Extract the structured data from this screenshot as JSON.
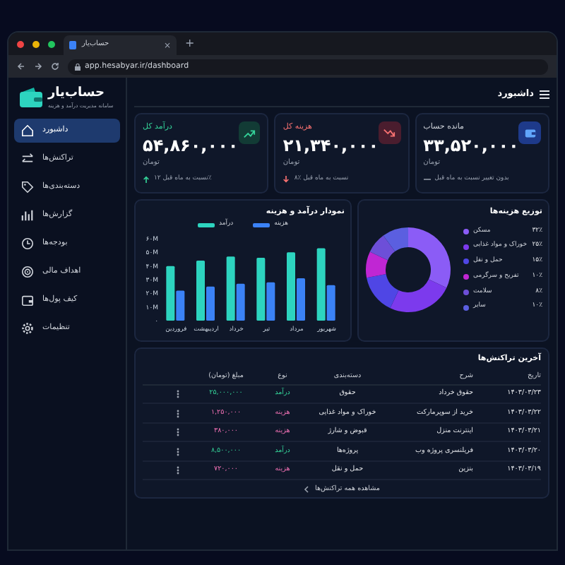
{
  "browser": {
    "tab_title": "حساب‌یار",
    "tab_close": "×",
    "new_tab": "+",
    "url": "app.hesabyar.ir/dashboard"
  },
  "sidebar": {
    "app_name": "حساب‌یار",
    "app_subtitle": "سامانه مدیریت درآمد و هزینه",
    "items": [
      {
        "label": "داشبورد",
        "selected": true
      },
      {
        "label": "تراکنش‌ها",
        "selected": false
      },
      {
        "label": "دسته‌بندی‌ها",
        "selected": false
      },
      {
        "label": "گزارش‌ها",
        "selected": false
      },
      {
        "label": "بودجه‌ها",
        "selected": false
      },
      {
        "label": "اهداف مالی",
        "selected": false
      },
      {
        "label": "کیف پول‌ها",
        "selected": false
      },
      {
        "label": "تنظیمات",
        "selected": false
      }
    ]
  },
  "header": {
    "title": "داشبورد"
  },
  "cards": [
    {
      "kind": "balance",
      "title": "مانده حساب",
      "value": "۳۳,۵۲۰,۰۰۰",
      "unit": "تومان",
      "change": "بدون تغییر نسبت به ماه قبل"
    },
    {
      "kind": "expense",
      "title": "هزینه کل",
      "value": "۲۱,۳۴۰,۰۰۰",
      "unit": "تومان",
      "change": "۸٪ نسبت به ماه قبل"
    },
    {
      "kind": "income",
      "title": "درآمد کل",
      "value": "۵۴,۸۶۰,۰۰۰",
      "unit": "تومان",
      "change": "نسبت به ماه قبل ۱۲٪"
    }
  ],
  "bar_panel": {
    "chart_data": {
      "type": "bar",
      "title": "نمودار درآمد و هزینه",
      "categories": [
        "فروردین",
        "اردیبهشت",
        "خرداد",
        "تیر",
        "مرداد",
        "شهریور"
      ],
      "series": [
        {
          "name": "درآمد",
          "color": "#2dd4bf",
          "values": [
            40,
            44,
            47,
            46,
            50,
            53
          ]
        },
        {
          "name": "هزینه",
          "color": "#3b82f6",
          "values": [
            22,
            25,
            27,
            28,
            31,
            26
          ]
        }
      ],
      "legend": "top",
      "ylim": [
        0,
        60
      ],
      "yticks": [
        {
          "value": 0,
          "label": "۰"
        },
        {
          "value": 10,
          "label": "۱۰M"
        },
        {
          "value": 20,
          "label": "۲۰M"
        },
        {
          "value": 30,
          "label": "۳۰M"
        },
        {
          "value": 40,
          "label": "۴۰M"
        },
        {
          "value": 50,
          "label": "۵۰M"
        },
        {
          "value": 60,
          "label": "۶۰M"
        }
      ]
    }
  },
  "donut_panel": {
    "chart_data": {
      "type": "donut",
      "title": "توزیع هزینه‌ها",
      "categories": [
        "مسکن",
        "خوراک و مواد غذایی",
        "حمل و نقل",
        "تفریح و سرگرمی",
        "سلامت",
        "سایر"
      ],
      "legend": "right",
      "values": [
        32,
        25,
        15,
        10,
        8,
        10
      ],
      "value_labels": [
        "۳۲٪",
        "۲۵٪",
        "۱۵٪",
        "۱۰٪",
        "۸٪",
        "۱۰٪"
      ],
      "colors": [
        "#8b5cf6",
        "#7c3aed",
        "#4f46e5",
        "#c026d3",
        "#6d4fd8",
        "#5b5fe0"
      ]
    }
  },
  "transactions": {
    "title": "آخرین تراکنش‌ها",
    "columns": [
      "تاریخ",
      "شرح",
      "دسته‌بندی",
      "نوع",
      "مبلغ (تومان)"
    ],
    "rows": [
      {
        "kind": "income",
        "cells": [
          "۱۴۰۳/۰۳/۲۳",
          "حقوق خرداد",
          "حقوق",
          "درآمد",
          "۲۵,۰۰۰,۰۰۰"
        ]
      },
      {
        "kind": "expense",
        "cells": [
          "۱۴۰۳/۰۳/۲۲",
          "خرید از سوپرمارکت",
          "خوراک و مواد غذایی",
          "هزینه",
          "۱,۲۵۰,۰۰۰"
        ]
      },
      {
        "kind": "expense",
        "cells": [
          "۱۴۰۳/۰۳/۲۱",
          "اینترنت منزل",
          "قبوض و شارژ",
          "هزینه",
          "۳۸۰,۰۰۰"
        ]
      },
      {
        "kind": "income",
        "cells": [
          "۱۴۰۳/۰۳/۲۰",
          "فریلنسری پروژه وب",
          "پروژه‌ها",
          "درآمد",
          "۸,۵۰۰,۰۰۰"
        ]
      },
      {
        "kind": "expense",
        "cells": [
          "۱۴۰۳/۰۳/۱۹",
          "بنزین",
          "حمل و نقل",
          "هزینه",
          "۷۲۰,۰۰۰"
        ]
      }
    ],
    "view_all": "مشاهده همه تراکنش‌ها"
  }
}
